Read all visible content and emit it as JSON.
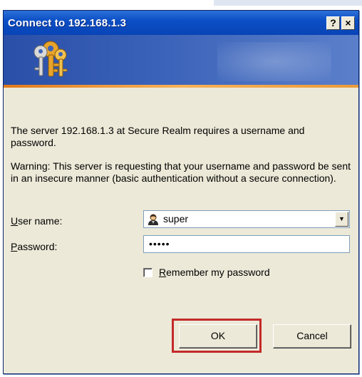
{
  "window": {
    "title": "Connect to 192.168.1.3",
    "help_button": "?",
    "close_button": "×"
  },
  "icons": {
    "banner": "keys-icon",
    "user": "user-icon",
    "dropdown": "dropdown-arrow-icon"
  },
  "message": {
    "line1": "The server 192.168.1.3 at Secure Realm requires a username and password.",
    "line2": "Warning: This server is requesting that your username and password be sent in an insecure manner (basic authentication without a secure connection)."
  },
  "form": {
    "username_label_first": "U",
    "username_label_rest": "ser name:",
    "username_value": "super",
    "password_label_first": "P",
    "password_label_rest": "assword:",
    "password_value": "•••••",
    "remember_first": "R",
    "remember_rest": "emember my password",
    "remember_checked": false
  },
  "buttons": {
    "ok": "OK",
    "cancel": "Cancel"
  },
  "colors": {
    "title_bar": "#0b4fc6",
    "highlight_border": "#c32a2a"
  }
}
